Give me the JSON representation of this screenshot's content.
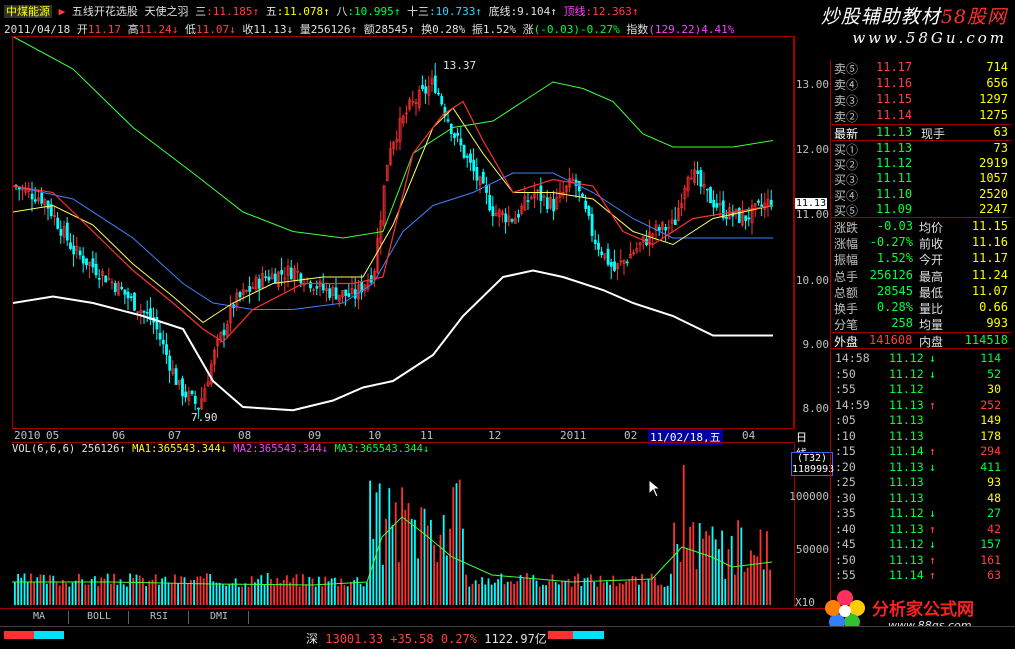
{
  "topbar": {
    "row1": {
      "stock_name": "中煤能源",
      "arrow": "▶",
      "formula_name": "五线开花选股",
      "angel": "天使之羽",
      "san_label": "三",
      "san_value": ":11.185↑",
      "wu_label": "五",
      "wu_value": ":11.078↑",
      "ba_label": "八",
      "ba_value": ":10.995↑",
      "shisan_label": "十三",
      "shisan_value": ":10.733↑",
      "dixian_label": "底线",
      "dixian_value": ":9.104↑",
      "dingxian_label": "顶线",
      "dingxian_value": ":12.363↑"
    },
    "row2": {
      "date": "2011/04/18",
      "open_label": "开",
      "open": "11.17",
      "high_label": "高",
      "high": "11.24↓",
      "low_label": "低",
      "low": "11.07↓",
      "close_label": "收",
      "close": "11.13↓",
      "vol_label": "量",
      "vol": "256126↑",
      "amt_label": "额",
      "amt": "28545↑",
      "turnover_label": "换",
      "turnover": "0.28%",
      "amp_label": "振",
      "amp": "1.52%",
      "chg_label": "涨",
      "chg": "(-0.03)-0.27%",
      "index_label": "指数",
      "index": "(129.22)4.41%"
    }
  },
  "logo": {
    "line1_a": "炒股辅助教材",
    "line1_b": "58股网",
    "line2": "www.58Gu.com"
  },
  "main_chart": {
    "y_ticks": [
      "13.00",
      "12.00",
      "11.00",
      "10.00",
      "9.00",
      "8.00"
    ],
    "current_price_label": "11.13",
    "high_annotation": "13.37",
    "low_annotation": "7.90",
    "x_ticks": [
      "2010",
      "05",
      "06",
      "07",
      "08",
      "09",
      "10",
      "11",
      "12",
      "2011",
      "02",
      "03",
      "04"
    ],
    "cursor_label": "11/02/18,五",
    "period": "日线"
  },
  "volume_chart": {
    "header_name": "VOL(6,6,6)",
    "vol_value": "256126↑",
    "ma1": "MA1:365543.344↓",
    "ma2": "MA2:365543.344↓",
    "ma3": "MA3:365543.344↓",
    "y_ticks": [
      "100000",
      "50000"
    ],
    "box_label": "(T32)",
    "box_value": "1189993",
    "unit": "X10"
  },
  "quote_panel": {
    "asks": [
      {
        "label": "卖⑤",
        "price": "11.17",
        "vol": "714"
      },
      {
        "label": "卖④",
        "price": "11.16",
        "vol": "656"
      },
      {
        "label": "卖③",
        "price": "11.15",
        "vol": "1297"
      },
      {
        "label": "卖②",
        "price": "11.14",
        "vol": "1275"
      }
    ],
    "latest_label": "最新",
    "latest_price": "11.13",
    "current_hand_label": "现手",
    "current_hand": "63",
    "bids": [
      {
        "label": "买①",
        "price": "11.13",
        "vol": "73"
      },
      {
        "label": "买②",
        "price": "11.12",
        "vol": "2919"
      },
      {
        "label": "买③",
        "price": "11.11",
        "vol": "1057"
      },
      {
        "label": "买④",
        "price": "11.10",
        "vol": "2520"
      },
      {
        "label": "买⑤",
        "price": "11.09",
        "vol": "2247"
      }
    ],
    "stats": [
      {
        "l1": "涨跌",
        "v1": "-0.03",
        "l2": "均价",
        "v2": "11.15"
      },
      {
        "l1": "涨幅",
        "v1": "-0.27%",
        "l2": "前收",
        "v2": "11.16"
      },
      {
        "l1": "振幅",
        "v1": "1.52%",
        "l2": "今开",
        "v2": "11.17"
      },
      {
        "l1": "总手",
        "v1": "256126",
        "l2": "最高",
        "v2": "11.24"
      },
      {
        "l1": "总额",
        "v1": "28545",
        "l2": "最低",
        "v2": "11.07"
      },
      {
        "l1": "换手",
        "v1": "0.28%",
        "l2": "量比",
        "v2": "0.66"
      },
      {
        "l1": "分笔",
        "v1": "258",
        "l2": "均量",
        "v2": "993"
      }
    ],
    "outer_label": "外盘",
    "outer": "141608",
    "inner_label": "内盘",
    "inner": "114518",
    "ticks": [
      {
        "t": "14:58",
        "p": "11.12",
        "a": "↓",
        "v": "114"
      },
      {
        "t": ":50",
        "p": "11.12",
        "a": "↓",
        "v": "52"
      },
      {
        "t": ":55",
        "p": "11.12",
        "a": "",
        "v": "30"
      },
      {
        "t": "14:59",
        "p": "11.13",
        "a": "↑",
        "v": "252"
      },
      {
        "t": ":05",
        "p": "11.13",
        "a": "",
        "v": "149"
      },
      {
        "t": ":10",
        "p": "11.13",
        "a": "",
        "v": "178"
      },
      {
        "t": ":15",
        "p": "11.14",
        "a": "↑",
        "v": "294"
      },
      {
        "t": ":20",
        "p": "11.13",
        "a": "↓",
        "v": "411"
      },
      {
        "t": ":25",
        "p": "11.13",
        "a": "",
        "v": "93"
      },
      {
        "t": ":30",
        "p": "11.13",
        "a": "",
        "v": "48"
      },
      {
        "t": ":35",
        "p": "11.12",
        "a": "↓",
        "v": "27"
      },
      {
        "t": ":40",
        "p": "11.13",
        "a": "↑",
        "v": "42"
      },
      {
        "t": ":45",
        "p": "11.12",
        "a": "↓",
        "v": "157"
      },
      {
        "t": ":50",
        "p": "11.13",
        "a": "↑",
        "v": "161"
      },
      {
        "t": ":55",
        "p": "11.14",
        "a": "↑",
        "v": "63"
      }
    ]
  },
  "bottom_tabs": [
    "MA",
    "BOLL",
    "RSI",
    "DMI"
  ],
  "status_bar": {
    "market": "深",
    "index_value": "13001.33",
    "change": "+35.58",
    "pct": "0.27%",
    "amount": "1122.97亿"
  },
  "brand": {
    "name": "分析家公式网",
    "url": "www.88gs.com"
  },
  "colors": {
    "up": "#ff3030",
    "down": "#00ffff",
    "grid_border": "#a00000",
    "ma_yellow": "#ffff60",
    "ma_green": "#40ff40",
    "ma_blue": "#4080ff",
    "white_line": "#ffffff"
  }
}
